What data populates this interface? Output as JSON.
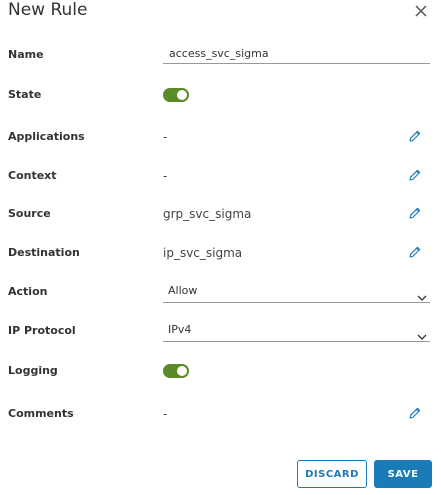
{
  "dialog": {
    "title": "New Rule",
    "close_icon": "close-icon"
  },
  "fields": {
    "name": {
      "label": "Name",
      "value": "access_svc_sigma"
    },
    "state": {
      "label": "State",
      "enabled": true
    },
    "applications": {
      "label": "Applications",
      "value": "-"
    },
    "context": {
      "label": "Context",
      "value": "-"
    },
    "source": {
      "label": "Source",
      "value": "grp_svc_sigma"
    },
    "destination": {
      "label": "Destination",
      "value": "ip_svc_sigma"
    },
    "action": {
      "label": "Action",
      "selected": "Allow"
    },
    "ip_protocol": {
      "label": "IP Protocol",
      "selected": "IPv4"
    },
    "logging": {
      "label": "Logging",
      "enabled": true
    },
    "comments": {
      "label": "Comments",
      "value": "-"
    }
  },
  "footer": {
    "discard_label": "DISCARD",
    "save_label": "SAVE"
  },
  "colors": {
    "accent": "#1b7bb6",
    "toggle_on": "#5b8a29",
    "edit_icon": "#1b7bb6"
  }
}
